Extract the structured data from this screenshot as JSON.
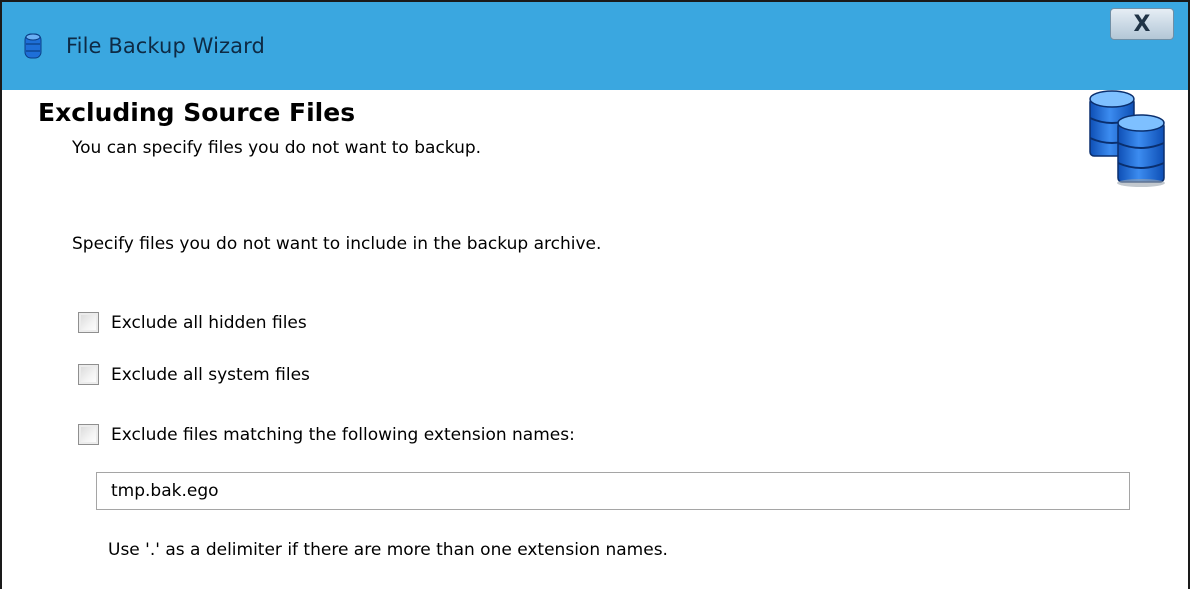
{
  "window": {
    "title": "File Backup Wizard",
    "close_label": "X",
    "icons": {
      "title": "database-icon",
      "header": "databases-icon",
      "close": "close-icon"
    },
    "colors": {
      "titlebar": "#3aa7e0",
      "db_blue": "#1e6fd8"
    }
  },
  "page": {
    "heading": "Excluding Source Files",
    "subheading": "You can specify files you do not want to backup.",
    "instruction": "Specify files you do not want to include in the backup archive."
  },
  "options": [
    {
      "label": "Exclude all hidden files",
      "checked": false
    },
    {
      "label": "Exclude all system files",
      "checked": false
    },
    {
      "label": "Exclude files matching the following extension names:",
      "checked": false
    }
  ],
  "extension_input": {
    "value": "tmp.bak.ego"
  },
  "hint": "Use '.' as a delimiter if there are more than one extension names."
}
